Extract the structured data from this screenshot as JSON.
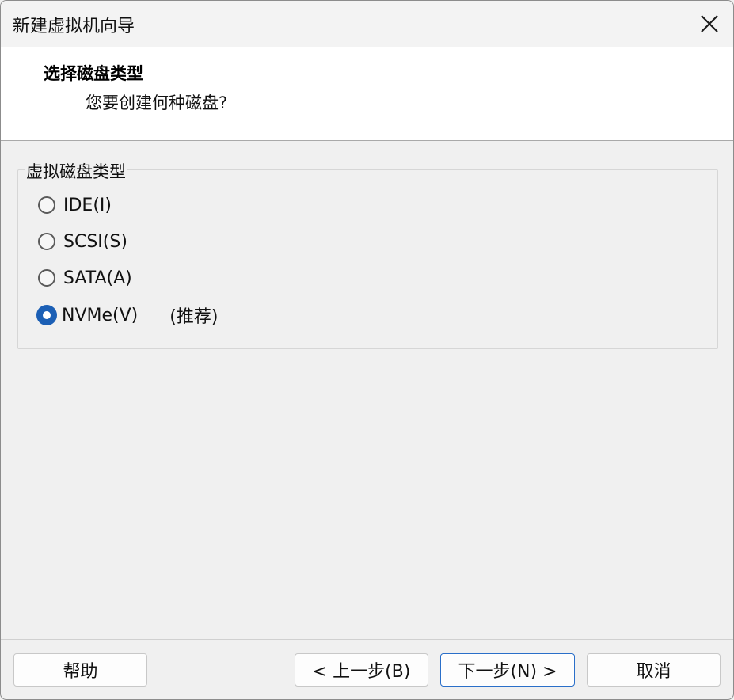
{
  "window": {
    "title": "新建虚拟机向导"
  },
  "header": {
    "title": "选择磁盘类型",
    "subtitle": "您要创建何种磁盘?"
  },
  "disk_type_group": {
    "label": "虚拟磁盘类型",
    "options": [
      {
        "label": "IDE(I)",
        "checked": false
      },
      {
        "label": "SCSI(S)",
        "checked": false
      },
      {
        "label": "SATA(A)",
        "checked": false
      },
      {
        "label": "NVMe(V)",
        "checked": true,
        "note": "(推荐)"
      }
    ]
  },
  "buttons": {
    "help": "帮助",
    "back": "< 上一步(B)",
    "next": "下一步(N) >",
    "cancel": "取消"
  },
  "icons": {
    "close": "close-icon"
  },
  "colors": {
    "accent": "#1b5fb5",
    "primary_button_border": "#2a6fc9"
  }
}
